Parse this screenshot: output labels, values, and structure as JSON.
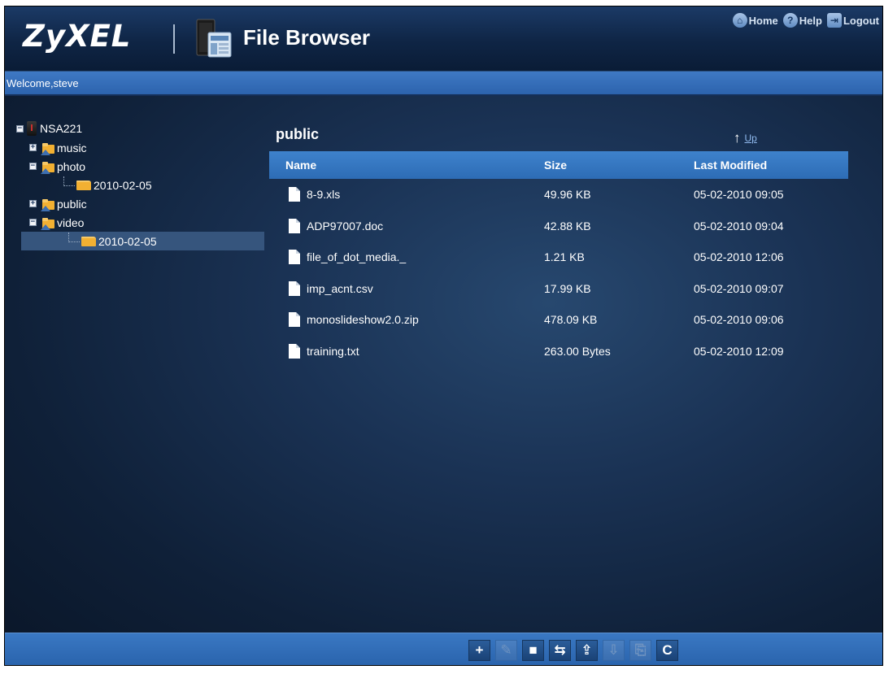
{
  "header": {
    "logo_text": "ZyXEL",
    "app_title": "File Browser",
    "nav": [
      {
        "label": "Home",
        "icon": "home-icon"
      },
      {
        "label": "Help",
        "icon": "help-icon"
      },
      {
        "label": "Logout",
        "icon": "logout-icon"
      }
    ]
  },
  "welcome": "Welcome,steve",
  "tree": {
    "root": "NSA221",
    "shares": [
      {
        "label": "music",
        "expanded": false
      },
      {
        "label": "photo",
        "expanded": true,
        "children": [
          "2010-02-05"
        ]
      },
      {
        "label": "public",
        "expanded": false
      },
      {
        "label": "video",
        "expanded": true,
        "children": [
          "2010-02-05"
        ]
      }
    ],
    "selected": "video/2010-02-05"
  },
  "panel": {
    "title": "public",
    "up_label": "Up",
    "columns": [
      "Name",
      "Size",
      "Last Modified"
    ],
    "files": [
      {
        "name": "8-9.xls",
        "size": "49.96 KB",
        "modified": "05-02-2010 09:05"
      },
      {
        "name": "ADP97007.doc",
        "size": "42.88 KB",
        "modified": "05-02-2010 09:04"
      },
      {
        "name": "file_of_dot_media._",
        "size": "1.21 KB",
        "modified": "05-02-2010 12:06"
      },
      {
        "name": "imp_acnt.csv",
        "size": "17.99 KB",
        "modified": "05-02-2010 09:07"
      },
      {
        "name": "monoslideshow2.0.zip",
        "size": "478.09 KB",
        "modified": "05-02-2010 09:06"
      },
      {
        "name": "training.txt",
        "size": "263.00 Bytes",
        "modified": "05-02-2010 12:09"
      }
    ]
  },
  "toolbar": {
    "buttons": [
      {
        "icon": "add-folder-icon",
        "glyph": "+",
        "enabled": true
      },
      {
        "icon": "rename-icon",
        "glyph": "✎",
        "enabled": false
      },
      {
        "icon": "delete-icon",
        "glyph": "■",
        "enabled": true
      },
      {
        "icon": "move-icon",
        "glyph": "⇆",
        "enabled": true
      },
      {
        "icon": "upload-icon",
        "glyph": "⇪",
        "enabled": true
      },
      {
        "icon": "download-icon",
        "glyph": "⇩",
        "enabled": false
      },
      {
        "icon": "copy-icon",
        "glyph": "⎘",
        "enabled": false
      },
      {
        "icon": "refresh-icon",
        "glyph": "C",
        "enabled": true
      }
    ]
  },
  "colors": {
    "background": "#1a3254",
    "bar": "#2e6ab2",
    "selected": "#36557d",
    "link": "#8fb8ec"
  }
}
